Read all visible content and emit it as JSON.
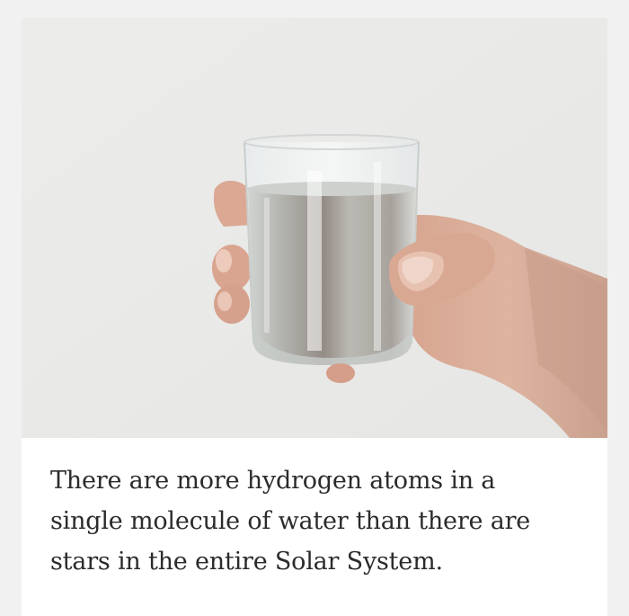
{
  "post": {
    "image": {
      "subject": "hand holding a glass of water",
      "colors": {
        "background": "#ebebea",
        "skin": "#d9aa95",
        "water": "#b6b8b4"
      }
    },
    "caption": "There are more hydrogen atoms in a single molecule of water than there are stars in the entire Solar System."
  }
}
